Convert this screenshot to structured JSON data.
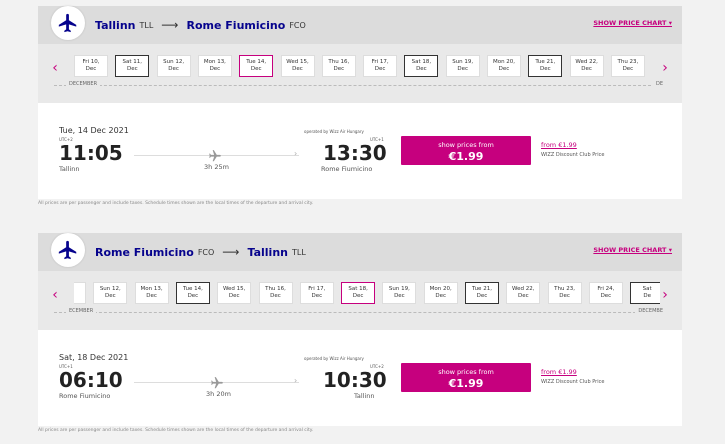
{
  "section1": {
    "origin": "Tallinn",
    "origin_code": "TLL",
    "destination": "Rome Fiumicino",
    "destination_code": "FCO",
    "show_chart": "SHOW PRICE CHART ▾",
    "days": [
      {
        "day": "Fri 10,",
        "mon": "Dec",
        "state": "normal"
      },
      {
        "day": "Sat 11,",
        "mon": "Dec",
        "state": "outlined"
      },
      {
        "day": "Sun 12,",
        "mon": "Dec",
        "state": "normal"
      },
      {
        "day": "Mon 13,",
        "mon": "Dec",
        "state": "normal"
      },
      {
        "day": "Tue 14,",
        "mon": "Dec",
        "state": "selected"
      },
      {
        "day": "Wed 15,",
        "mon": "Dec",
        "state": "normal"
      },
      {
        "day": "Thu 16,",
        "mon": "Dec",
        "state": "normal"
      },
      {
        "day": "Fri 17,",
        "mon": "Dec",
        "state": "normal"
      },
      {
        "day": "Sat 18,",
        "mon": "Dec",
        "state": "outlined"
      },
      {
        "day": "Sun 19,",
        "mon": "Dec",
        "state": "normal"
      },
      {
        "day": "Mon 20,",
        "mon": "Dec",
        "state": "normal"
      },
      {
        "day": "Tue 21,",
        "mon": "Dec",
        "state": "outlined"
      },
      {
        "day": "Wed 22,",
        "mon": "Dec",
        "state": "normal"
      },
      {
        "day": "Thu 23,",
        "mon": "Dec",
        "state": "normal"
      }
    ],
    "month_left": "DECEMBER",
    "month_right": "DE",
    "flight": {
      "date": "Tue, 14 Dec 2021",
      "operated_by": "operated by Wizz Air Hungary",
      "dep_utc": "UTC+2",
      "dep_time": "11:05",
      "dep_city": "Tallinn",
      "duration": "3h 25m",
      "arr_utc": "UTC+1",
      "arr_time": "13:30",
      "arr_city": "Rome Fiumicino",
      "price_label": "show prices from",
      "price": "€1.99",
      "club_link": "from €1.99",
      "club_text": "WIZZ Discount Club Price"
    },
    "footnote": "All prices are per passenger and include taxes. Schedule times shown are the local times of the departure and arrival city."
  },
  "section2": {
    "origin": "Rome Fiumicino",
    "origin_code": "FCO",
    "destination": "Tallinn",
    "destination_code": "TLL",
    "show_chart": "SHOW PRICE CHART ▾",
    "days": [
      {
        "day": "11,",
        "mon": "ec",
        "state": "normal"
      },
      {
        "day": "Sun 12,",
        "mon": "Dec",
        "state": "normal"
      },
      {
        "day": "Mon 13,",
        "mon": "Dec",
        "state": "normal"
      },
      {
        "day": "Tue 14,",
        "mon": "Dec",
        "state": "outlined"
      },
      {
        "day": "Wed 15,",
        "mon": "Dec",
        "state": "normal"
      },
      {
        "day": "Thu 16,",
        "mon": "Dec",
        "state": "normal"
      },
      {
        "day": "Fri 17,",
        "mon": "Dec",
        "state": "normal"
      },
      {
        "day": "Sat 18,",
        "mon": "Dec",
        "state": "selected"
      },
      {
        "day": "Sun 19,",
        "mon": "Dec",
        "state": "normal"
      },
      {
        "day": "Mon 20,",
        "mon": "Dec",
        "state": "normal"
      },
      {
        "day": "Tue 21,",
        "mon": "Dec",
        "state": "outlined"
      },
      {
        "day": "Wed 22,",
        "mon": "Dec",
        "state": "normal"
      },
      {
        "day": "Thu 23,",
        "mon": "Dec",
        "state": "normal"
      },
      {
        "day": "Fri 24,",
        "mon": "Dec",
        "state": "normal"
      },
      {
        "day": "Sat",
        "mon": "De",
        "state": "outlined"
      }
    ],
    "month_left": "ECEMBER",
    "month_right": "DECEMBE",
    "flight": {
      "date": "Sat, 18 Dec 2021",
      "operated_by": "operated by Wizz Air Hungary",
      "dep_utc": "UTC+1",
      "dep_time": "06:10",
      "dep_city": "Rome Fiumicino",
      "duration": "3h 20m",
      "arr_utc": "UTC+2",
      "arr_time": "10:30",
      "arr_city": "Tallinn",
      "price_label": "show prices from",
      "price": "€1.99",
      "club_link": "from €1.99",
      "club_text": "WIZZ Discount Club Price"
    },
    "footnote": "All prices are per passenger and include taxes. Schedule times shown are the local times of the departure and arrival city."
  },
  "colors": {
    "brand_magenta": "#c6007e",
    "brand_navy": "#06038d"
  },
  "icons": {
    "badge": "plane-icon",
    "left": "chevron-left-icon",
    "right": "chevron-right-icon"
  }
}
